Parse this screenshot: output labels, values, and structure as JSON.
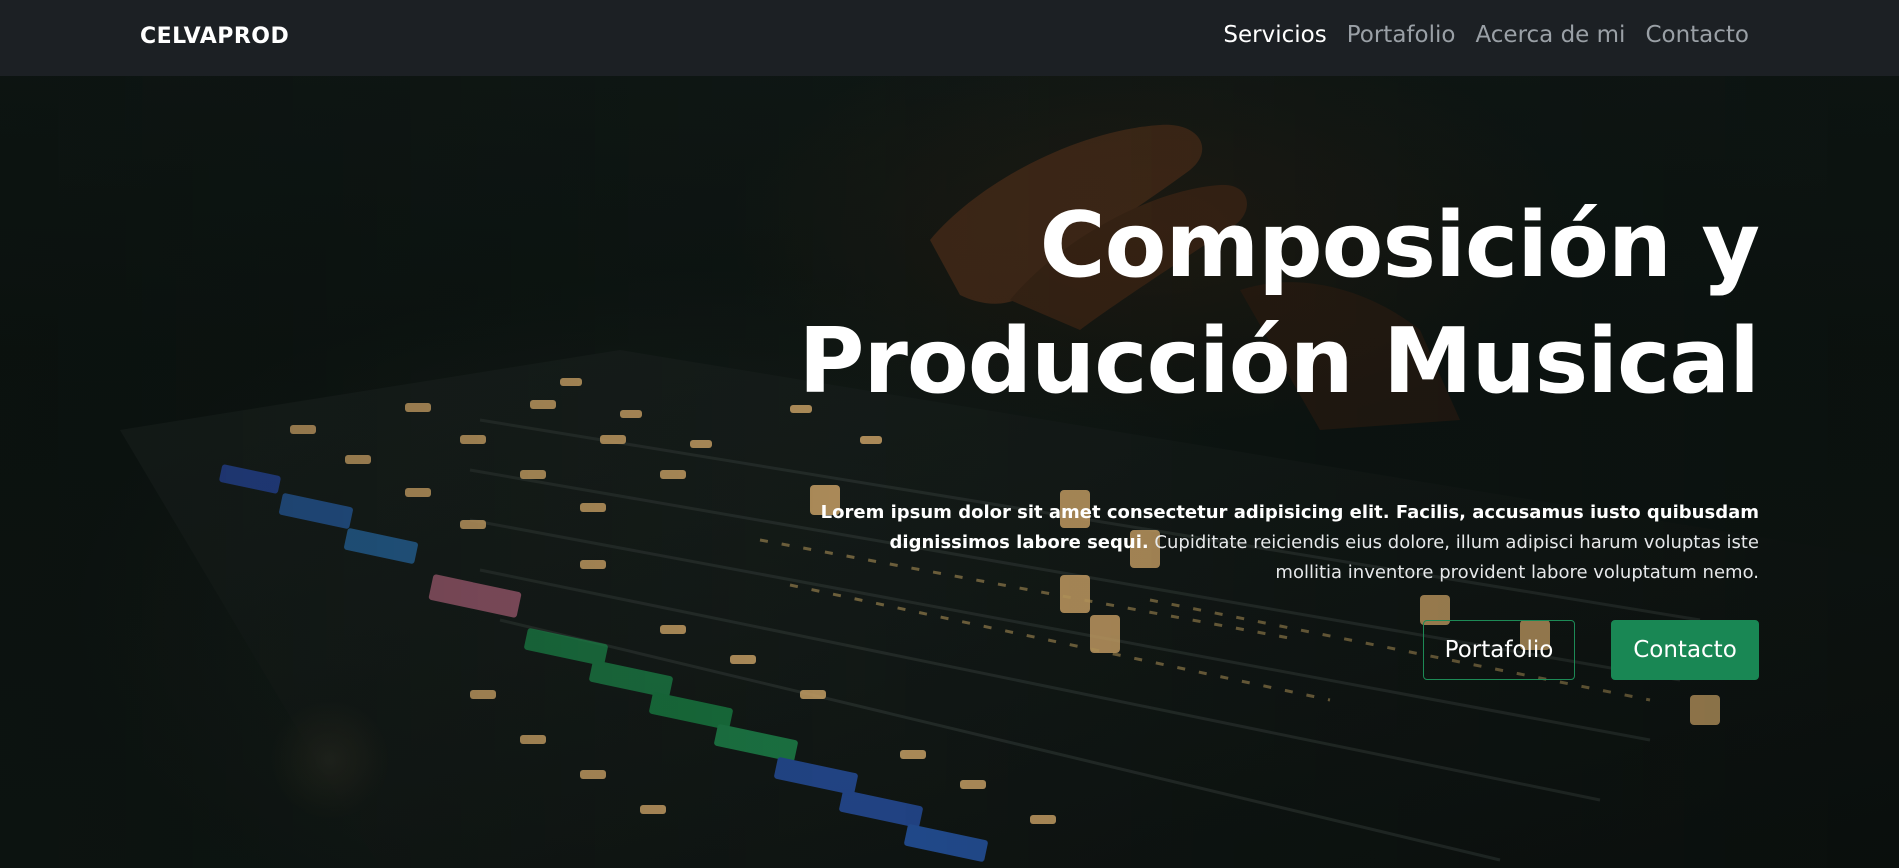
{
  "navbar": {
    "brand": "CELVAPROD",
    "links": [
      {
        "label": "Servicios",
        "active": true
      },
      {
        "label": "Portafolio",
        "active": false
      },
      {
        "label": "Acerca de mi",
        "active": false
      },
      {
        "label": "Contacto",
        "active": false
      }
    ]
  },
  "hero": {
    "title_line1": "Composición y",
    "title_line2": "Producción Musical",
    "lead_bold": "Lorem ipsum dolor sit amet consectetur adipisicing elit. Facilis, accusamus iusto quibusdam dignissimos labore sequi.",
    "lead_rest": " Cupiditate reiciendis eius dolore, illum adipisci harum voluptas iste mollitia inventore provident labore voluptatum nemo.",
    "buttons": {
      "portfolio_label": "Portafolio",
      "contact_label": "Contacto"
    },
    "background_image": "music-mixer-photo"
  },
  "colors": {
    "navbar_bg": "#1c2024",
    "accent_green": "#198754",
    "text_primary": "#ffffff",
    "text_muted": "#9aa0a6"
  }
}
